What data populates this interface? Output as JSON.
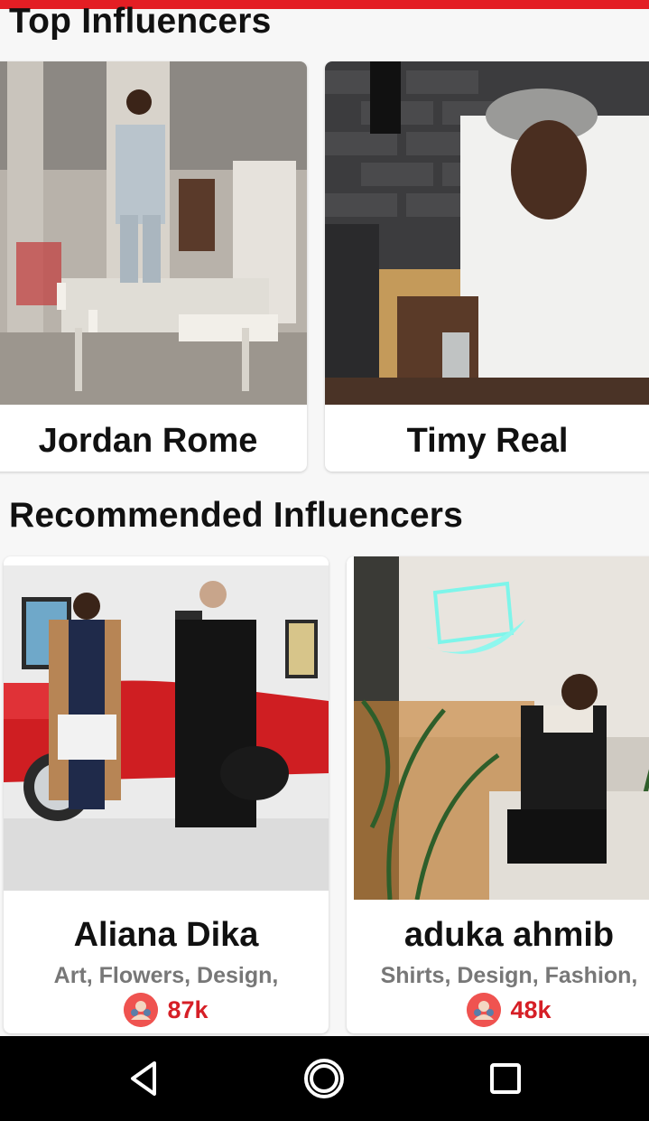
{
  "top_section": {
    "title": "Top Influencers",
    "influencers": [
      {
        "name": "Jordan Rome"
      },
      {
        "name": "Timy Real"
      }
    ]
  },
  "recommended_section": {
    "title": "Recommended Influencers",
    "influencers": [
      {
        "name": "Aliana Dika",
        "tags": "Art, Flowers, Design,",
        "followers": "87k"
      },
      {
        "name": "aduka ahmib",
        "tags": "Shirts, Design, Fashion,",
        "followers": "48k"
      }
    ]
  },
  "colors": {
    "accent": "#e31e24",
    "follower_count": "#d61f26",
    "follower_icon_bg": "#ef5350",
    "tags_text": "#777777"
  },
  "icons": {
    "followers": "people-icon",
    "nav_back": "back-triangle-icon",
    "nav_home": "home-circle-icon",
    "nav_recents": "recents-square-icon"
  }
}
